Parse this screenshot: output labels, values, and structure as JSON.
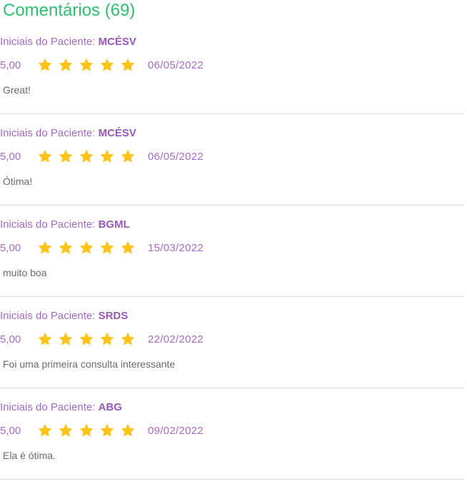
{
  "section": {
    "title": "Comentários (69)"
  },
  "patient_label": "Iniciais do Paciente:",
  "colors": {
    "title": "#2fbf71",
    "accent_purple": "#a56cc1",
    "star": "#fcc419",
    "comment": "#6b6b6b",
    "divider": "#dcdcdc"
  },
  "star_icon": "star-icon",
  "reviews": [
    {
      "initials": "MCÉSV",
      "rating": "5,00",
      "stars": 5,
      "date": "06/05/2022",
      "comment": "Great!"
    },
    {
      "initials": "MCÉSV",
      "rating": "5,00",
      "stars": 5,
      "date": "06/05/2022",
      "comment": "Ótima!"
    },
    {
      "initials": "BGML",
      "rating": "5,00",
      "stars": 5,
      "date": "15/03/2022",
      "comment": "muito boa"
    },
    {
      "initials": "SRDS",
      "rating": "5,00",
      "stars": 5,
      "date": "22/02/2022",
      "comment": "Foi uma primeira consulta interessante"
    },
    {
      "initials": "ABG",
      "rating": "5,00",
      "stars": 5,
      "date": "09/02/2022",
      "comment": "Ela é ótima."
    }
  ]
}
